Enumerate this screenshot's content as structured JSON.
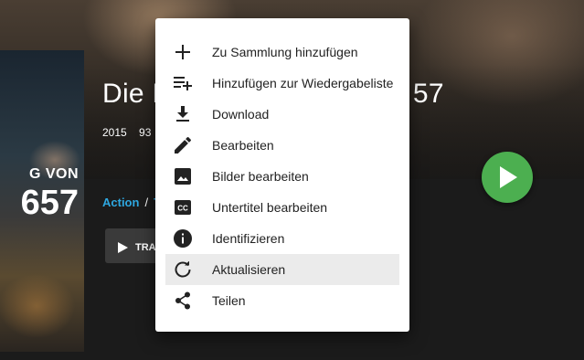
{
  "colors": {
    "accent_genre": "#2ea7e0",
    "play_button": "#4caf50",
    "menu_highlight": "#ebebeb"
  },
  "poster": {
    "line1": "G VON",
    "line2": "657"
  },
  "movie": {
    "title_left": "Die E",
    "title_right": "57",
    "year": "2015",
    "runtime_partial": "93"
  },
  "genres": {
    "first": "Action",
    "separator": "/",
    "second_partial": "T"
  },
  "trailer_button": {
    "label": "TRA",
    "icon": "play-arrow-icon"
  },
  "context_menu": {
    "items": [
      {
        "label": "Zu Sammlung hinzufügen",
        "icon": "add-icon",
        "highlighted": false
      },
      {
        "label": "Hinzufügen zur Wiedergabeliste",
        "icon": "playlist-add-icon",
        "highlighted": false
      },
      {
        "label": "Download",
        "icon": "download-icon",
        "highlighted": false
      },
      {
        "label": "Bearbeiten",
        "icon": "edit-icon",
        "highlighted": false
      },
      {
        "label": "Bilder bearbeiten",
        "icon": "image-icon",
        "highlighted": false
      },
      {
        "label": "Untertitel bearbeiten",
        "icon": "closed-caption-icon",
        "highlighted": false
      },
      {
        "label": "Identifizieren",
        "icon": "info-icon",
        "highlighted": false
      },
      {
        "label": "Aktualisieren",
        "icon": "refresh-icon",
        "highlighted": true
      },
      {
        "label": "Teilen",
        "icon": "share-icon",
        "highlighted": false
      }
    ]
  }
}
